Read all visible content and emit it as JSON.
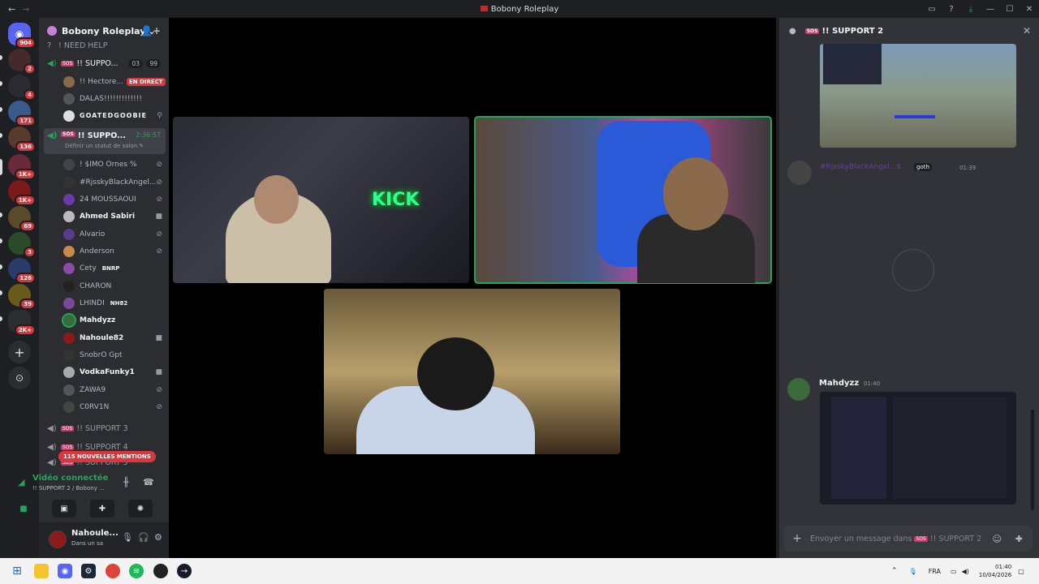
{
  "window": {
    "title": "Bobony Roleplay",
    "back": "←",
    "forward": "→"
  },
  "servers": {
    "badges": [
      "904",
      "2",
      "4",
      "171",
      "136",
      "1K+",
      "1K+",
      "69",
      "3",
      "126",
      "39",
      "2K+"
    ],
    "add": "+",
    "explore": "⊙"
  },
  "guild": {
    "name": "Bobony Roleplay",
    "chevron": "⌄",
    "invite": "👤+"
  },
  "channels": {
    "need_help": "! NEED HELP",
    "support1": {
      "name": "!! SUPPO...",
      "tag": "SOS",
      "count1": "03",
      "count2": "99"
    },
    "support1_users": [
      {
        "name": "!! Hectore...",
        "live": "EN DIRECT"
      },
      {
        "name": "DALAS!!!!!!!!!!!!!"
      },
      {
        "name": "GOATEDGOOBIE"
      }
    ],
    "support2": {
      "name": "!! SUPPO...",
      "tag": "SOS",
      "timer": "2:36:57",
      "status": "Définir un statut de salon ✎"
    },
    "support2_users": [
      "! $IMO Ornes %",
      "#RjsskyBlackAngel...",
      "24 MOUSSAOUI",
      "Ahmed Sabiri",
      "Alvario",
      "Anderson",
      "Cety",
      "CHARON",
      "LHINDI",
      "Mahdyzz",
      "Nahoule82",
      "SnobrO Gpt",
      "VodkaFunky1",
      "ZAWA9",
      "C0RV1N"
    ],
    "cety_tag": "BNRP",
    "lhindi_tag": "NH82",
    "support3": "!! SUPPORT 3",
    "support4": "!! SUPPORT 4",
    "support5": "!! SUPPORT 5",
    "mentions": "115 NOUVELLES MENTIONS"
  },
  "voice": {
    "connected": "Vidéo connectée",
    "location": "!! SUPPORT 2 / Bobony ..."
  },
  "user": {
    "name": "Nahoule...",
    "status": "Dans un sa"
  },
  "chat": {
    "title": "!! SUPPORT 2",
    "tag": "SOS",
    "close": "✕",
    "msg1_author": "#RjsskyBlackAngel...$",
    "msg1_role": "goth",
    "msg1_time": "01:39",
    "msg2_author": "Mahdyzz",
    "msg2_time": "01:40",
    "composer_placeholder": "Envoyer un message dans",
    "composer_channel": "!! SUPPORT 2"
  },
  "taskbar": {
    "lang": "FRA",
    "time": "01:40",
    "date": "10/04/2026"
  },
  "colors": {
    "green": "#23a55a",
    "red": "#da373c",
    "bg": "#313338"
  }
}
